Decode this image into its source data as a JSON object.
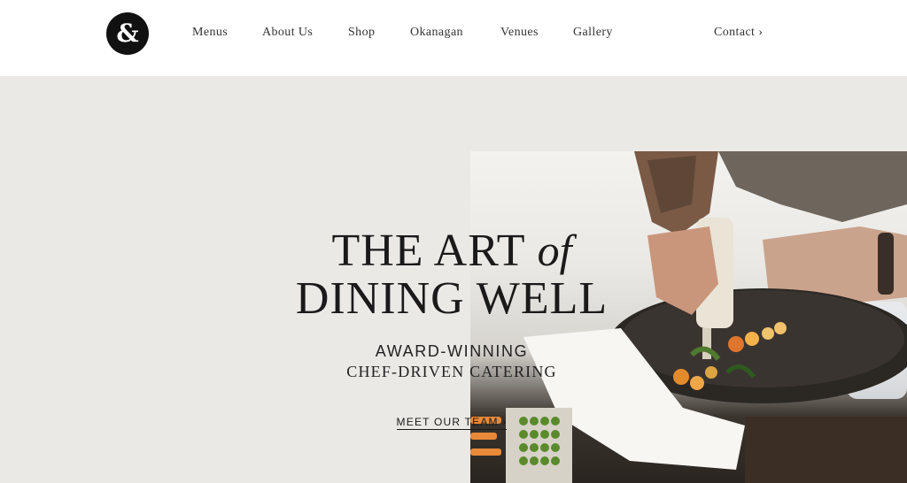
{
  "header": {
    "logo_glyph": "&",
    "nav": [
      {
        "label": "Menus"
      },
      {
        "label": "About Us"
      },
      {
        "label": "Shop"
      },
      {
        "label": "Okanagan"
      },
      {
        "label": "Venues"
      },
      {
        "label": "Gallery"
      }
    ],
    "contact_label": "Contact ›"
  },
  "hero": {
    "title_line1_main": "THE ART ",
    "title_line1_italic": "of",
    "title_line2": "DINING WELL",
    "subtitle_line1": "AWARD-WINNING",
    "subtitle_line2": "CHEF-DRIVEN CATERING",
    "cta_label": "MEET OUR TEAM ›",
    "photo_icon": "chef-plating-photo"
  },
  "colors": {
    "background": "#ebe9e6",
    "header_bg": "#ffffff",
    "logo_bg": "#111111",
    "text": "#1a1a1a"
  }
}
